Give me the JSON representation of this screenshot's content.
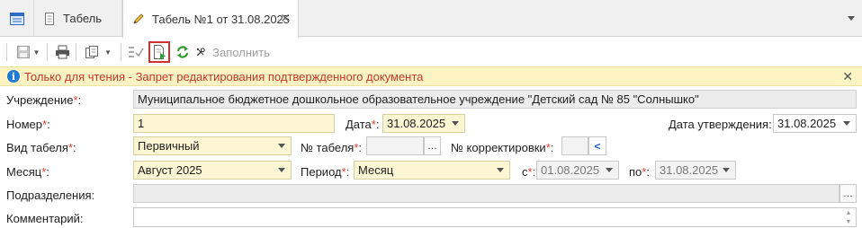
{
  "tabs": {
    "home_icon": "window-icon",
    "inactive": {
      "label": "Табель",
      "icon": "document-icon"
    },
    "active": {
      "label": "Табель №1 от 31.08.2025",
      "icon": "pencil-icon",
      "close": "✕"
    },
    "menu_icon": "chevron-down-icon"
  },
  "toolbar": {
    "buttons": [
      "save-icon",
      "print-icon",
      "copy-icon",
      "checklist-icon",
      "export-document-icon",
      "refresh-icon",
      "tools-icon"
    ],
    "fill_label": "Заполнить"
  },
  "info_bar": {
    "text": "Только для чтения - Запрет редактирования подтвержденного документа",
    "close": "✕"
  },
  "form": {
    "institution": {
      "label": "Учреждение",
      "value": "Муниципальное бюджетное дошкольное образовательное учреждение \"Детский сад № 85 \"Солнышко\""
    },
    "number": {
      "label": "Номер",
      "value": "1"
    },
    "date": {
      "label": "Дата",
      "value": "31.08.2025"
    },
    "approval_date": {
      "label": "Дата утверждения:",
      "value": "31.08.2025"
    },
    "timesheet_type": {
      "label": "Вид табеля",
      "value": "Первичный"
    },
    "timesheet_no": {
      "label": "№ табеля",
      "value": ""
    },
    "correction_no": {
      "label": "№ корректировки",
      "value": ""
    },
    "month": {
      "label": "Месяц",
      "value": "Август 2025"
    },
    "period": {
      "label": "Период",
      "value": "Месяц"
    },
    "from": {
      "label": "с",
      "value": "01.08.2025"
    },
    "to": {
      "label": "по",
      "value": "31.08.2025"
    },
    "subdivisions": {
      "label": "Подразделения:",
      "value": ""
    },
    "comment": {
      "label": "Комментарий:",
      "value": ""
    }
  },
  "colors": {
    "required": "#e23a2e",
    "info_text": "#c0392b",
    "info_bg": "#fdf3c3",
    "readonly_bg": "#fdf6d4"
  }
}
